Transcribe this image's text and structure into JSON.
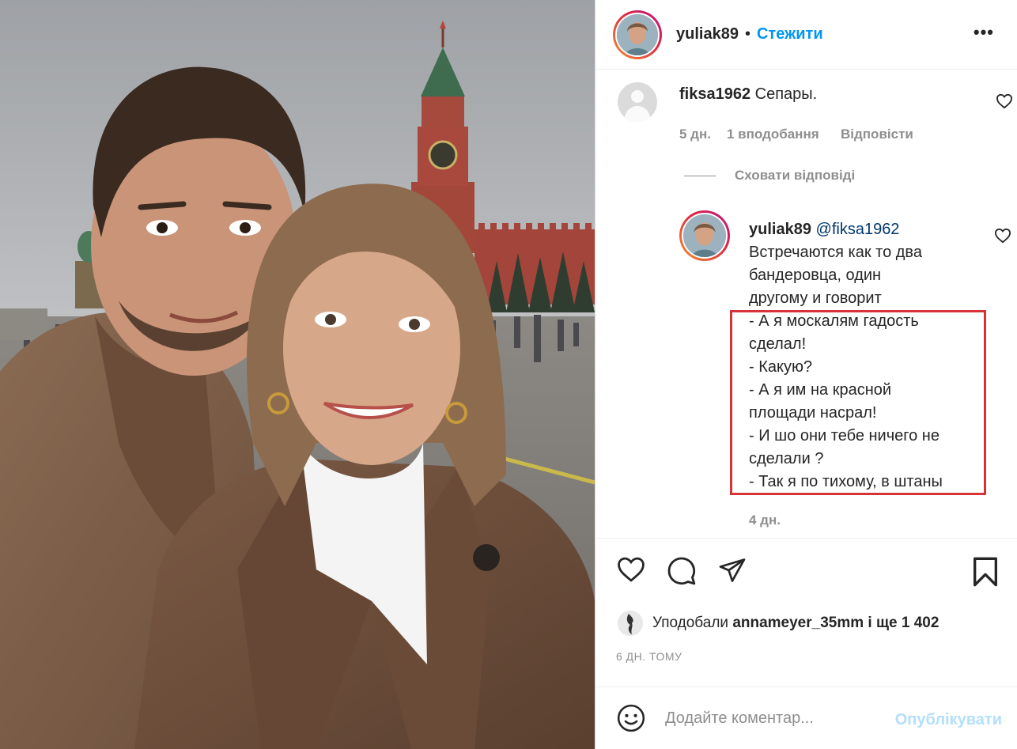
{
  "post": {
    "author": "yuliak89",
    "separator": "•",
    "follow_label": "Стежити",
    "more_label": "•••"
  },
  "comments": [
    {
      "username": "fiksa1962",
      "text": "Сепары.",
      "age": "5 дн.",
      "likes": "1 вподобання",
      "reply_label": "Відповісти"
    }
  ],
  "hide_replies_label": "Сховати відповіді",
  "reply": {
    "username": "yuliak89",
    "mention": "@fiksa1962",
    "lines": [
      "Встречаются как то два",
      "бандеровца, один",
      "другому и говорит",
      "- А я москалям гадость",
      "сделал!",
      "- Какую?",
      "- А я им на красной",
      "площади насрал!",
      "- И шо они тебе ничего не",
      "сделали ?",
      "- Так я по тихому, в штаны"
    ],
    "age": "4 дн."
  },
  "likes_summary": {
    "prefix": "Уподобали",
    "user": "annameyer_35mm",
    "suffix": "і ще 1 402"
  },
  "post_time": "6 ДН. ТОМУ",
  "add_comment": {
    "placeholder": "Додайте коментар...",
    "post_label": "Опублікувати"
  },
  "colors": {
    "accent": "#0095f6",
    "highlight_box": "#d7343a",
    "post_disabled": "#b2dffc"
  }
}
